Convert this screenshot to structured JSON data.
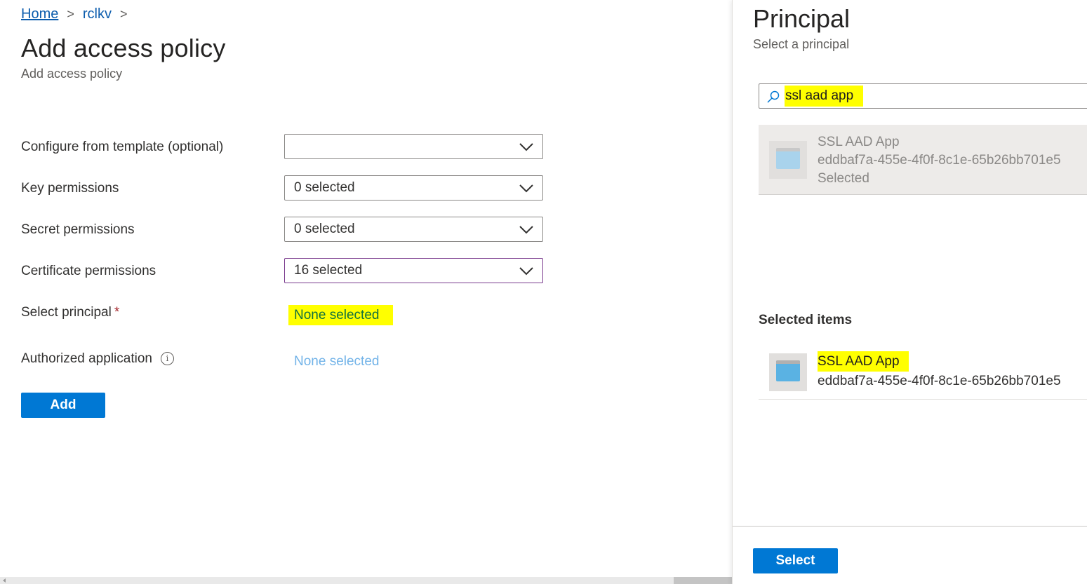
{
  "breadcrumb": {
    "home": "Home",
    "vault": "rclkv",
    "separator": ">"
  },
  "page": {
    "title": "Add access policy",
    "subtitle": "Add access policy"
  },
  "form": {
    "template_label": "Configure from template (optional)",
    "template_value": "",
    "key_label": "Key permissions",
    "key_value": "0 selected",
    "secret_label": "Secret permissions",
    "secret_value": "0 selected",
    "cert_label": "Certificate permissions",
    "cert_value": "16 selected",
    "principal_label": "Select principal",
    "principal_required": "*",
    "principal_value": "None selected",
    "auth_app_label": "Authorized application",
    "auth_app_info": "i",
    "auth_app_value": "None selected",
    "add_button": "Add"
  },
  "panel": {
    "title": "Principal",
    "subtitle": "Select a principal",
    "search_value": "ssl aad app",
    "result": {
      "name": "SSL AAD App",
      "id": "eddbaf7a-455e-4f0f-8c1e-65b26bb701e5",
      "status": "Selected"
    },
    "selected_heading": "Selected items",
    "selected_item": {
      "name": "SSL AAD App",
      "id": "eddbaf7a-455e-4f0f-8c1e-65b26bb701e5"
    },
    "select_button": "Select"
  },
  "colors": {
    "accent": "#0078d4",
    "highlight": "#ffff00",
    "link": "#0b5cad",
    "active_border": "#7a3b8e"
  }
}
